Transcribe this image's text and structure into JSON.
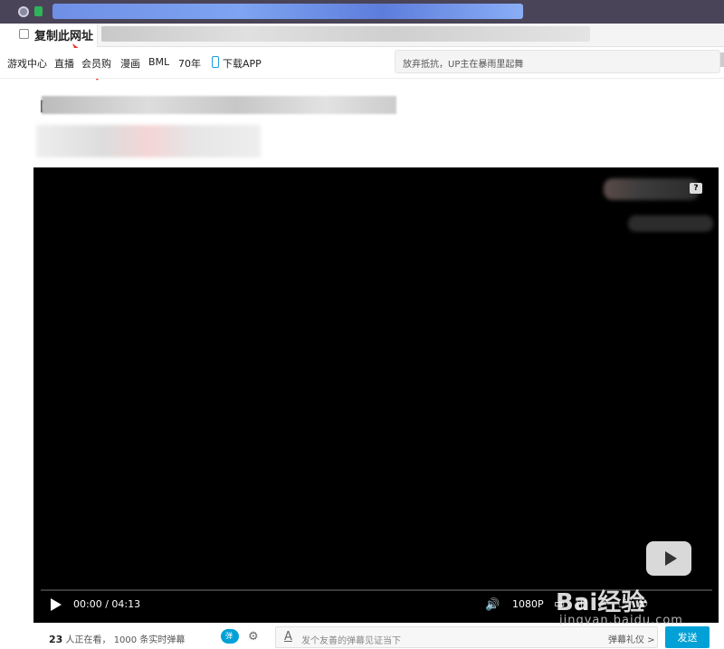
{
  "browser": {
    "copy_url_label": "复制此网址"
  },
  "nav": {
    "items": [
      "游戏中心",
      "直播",
      "会员购",
      "漫画",
      "BML",
      "70年"
    ],
    "download_app": "下载APP",
    "search_placeholder": "放弃抵抗，UP主在暴雨里起舞"
  },
  "player": {
    "help": "?",
    "time": "00:00 / 04:13",
    "quality": "1080P",
    "volume_icon": "speaker-icon"
  },
  "danmaku_bar": {
    "viewer_count": "23",
    "viewer_text": "人正在看，",
    "danmaku_count_text": "1000 条实时弹幕",
    "toggle_label": "弹",
    "input_placeholder": "发个友善的弹幕见证当下",
    "etiquette": "弹幕礼仪 >",
    "send": "发送"
  },
  "watermark": {
    "logo": "Bai经验",
    "url": "jingyan.baidu.com"
  },
  "title_bracket": "【"
}
